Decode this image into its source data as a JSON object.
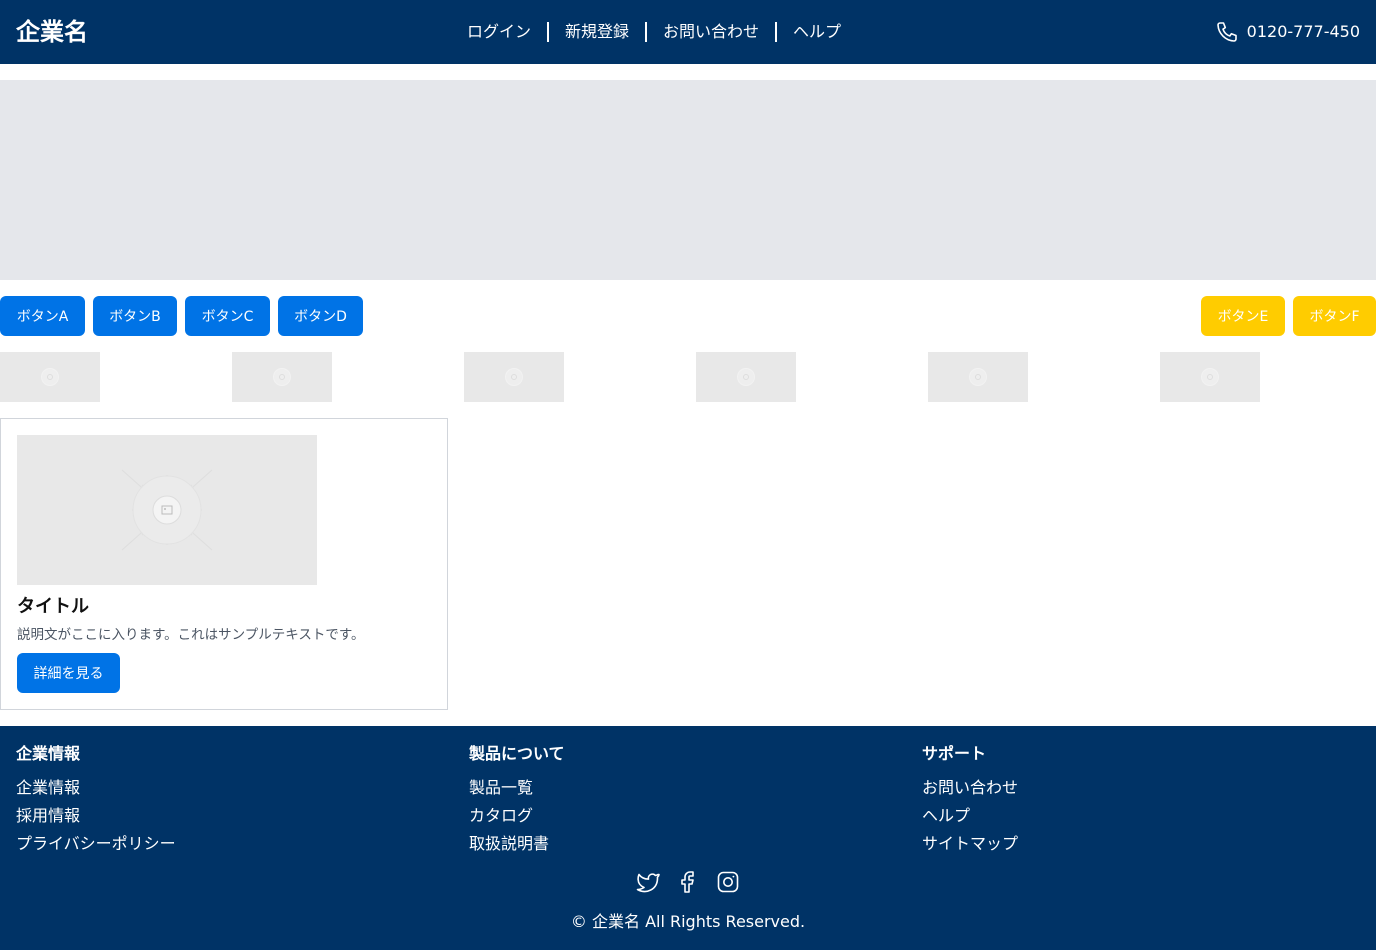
{
  "header": {
    "logo": "企業名",
    "nav": [
      "ログイン",
      "新規登録",
      "お問い合わせ",
      "ヘルプ"
    ],
    "phone": "0120-777-450",
    "bg_color": "#003366"
  },
  "buttons": {
    "a": "ボタンA",
    "b": "ボタンB",
    "c": "ボタンC",
    "d": "ボタンD",
    "e": "ボタンE",
    "f": "ボタンF",
    "primary_color": "#0073e6",
    "accent_color": "#ffcc00"
  },
  "card": {
    "title": "タイトル",
    "description": "説明文がここに入ります。これはサンプルテキストです。",
    "button": "詳細を見る"
  },
  "footer": {
    "columns": [
      {
        "title": "企業情報",
        "links": [
          "企業情報",
          "採用情報",
          "プライバシーポリシー"
        ]
      },
      {
        "title": "製品について",
        "links": [
          "製品一覧",
          "カタログ",
          "取扱説明書"
        ]
      },
      {
        "title": "サポート",
        "links": [
          "お問い合わせ",
          "ヘルプ",
          "サイトマップ"
        ]
      }
    ],
    "social": [
      "twitter-icon",
      "facebook-icon",
      "instagram-icon"
    ],
    "copyright": "© 企業名 All Rights Reserved."
  }
}
